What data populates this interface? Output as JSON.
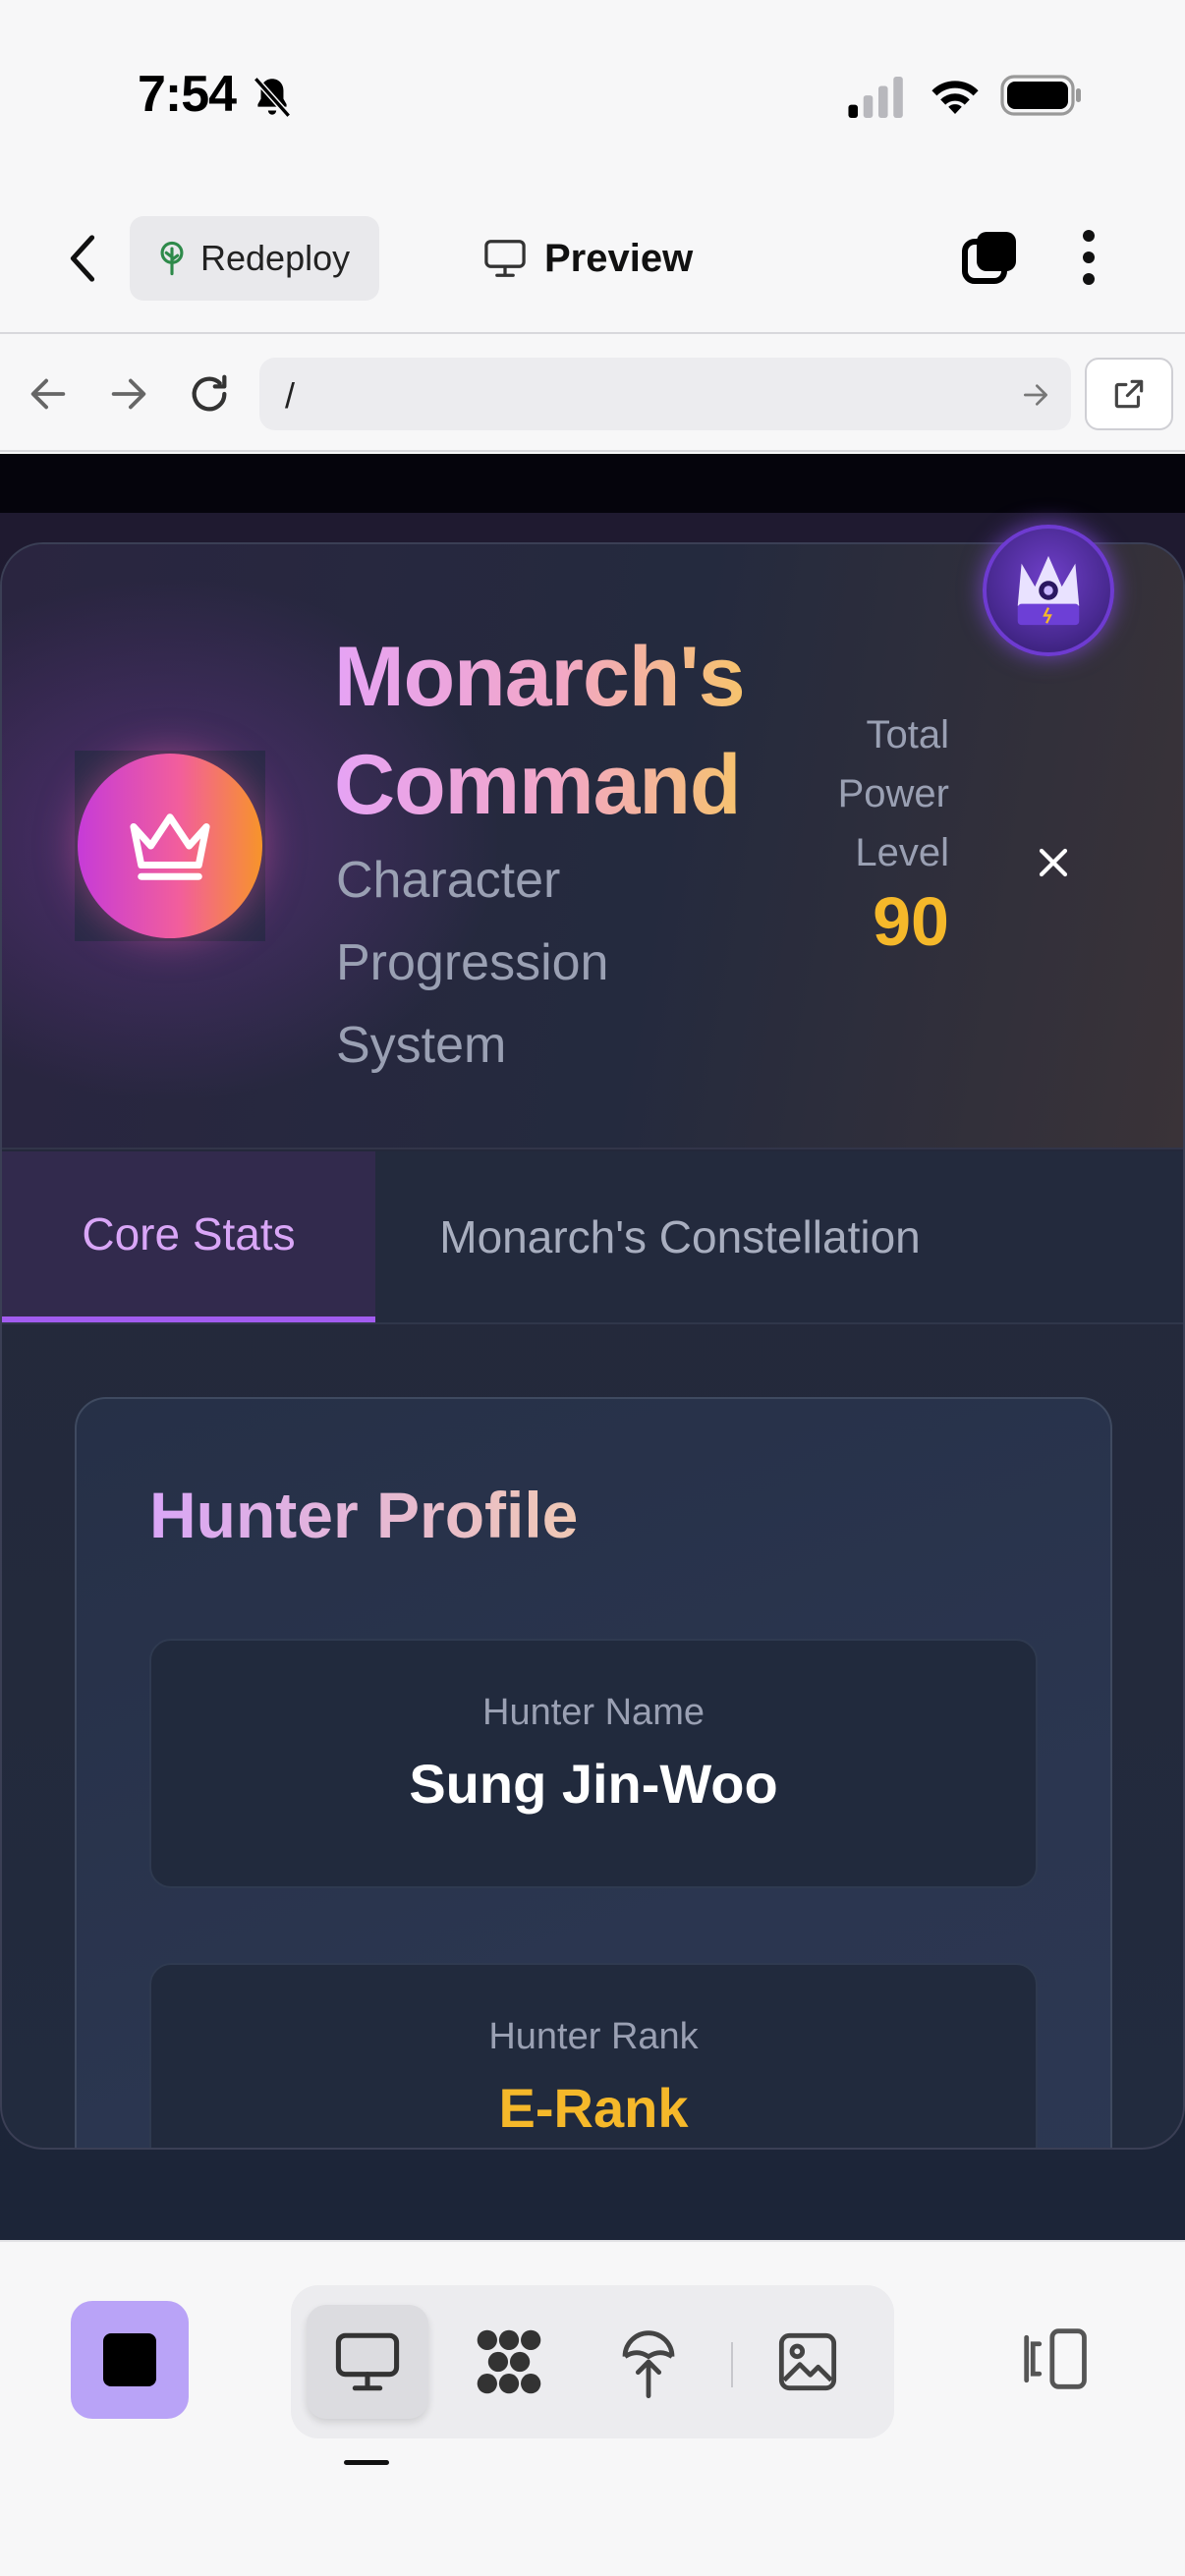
{
  "status_bar": {
    "time": "7:54"
  },
  "header": {
    "redeploy_label": "Redeploy",
    "preview_label": "Preview"
  },
  "browser": {
    "url": "/"
  },
  "modal": {
    "title_line1": "Monarch's",
    "title_line2": "Command",
    "subtitle": "Character Progression System",
    "power_label": "Total Power Level",
    "power_value": "90",
    "tabs": [
      {
        "label": "Core Stats",
        "active": true
      },
      {
        "label": "Monarch's Constellation",
        "active": false
      }
    ],
    "profile": {
      "title": "Hunter Profile",
      "fields": [
        {
          "label": "Hunter Name",
          "value": "Sung Jin-Woo"
        },
        {
          "label": "Hunter Rank",
          "value": "E-Rank"
        }
      ]
    }
  },
  "colors": {
    "accent_purple": "#a25cf0",
    "gold": "#f5b82a",
    "stop_button": "#b9a3f7"
  }
}
